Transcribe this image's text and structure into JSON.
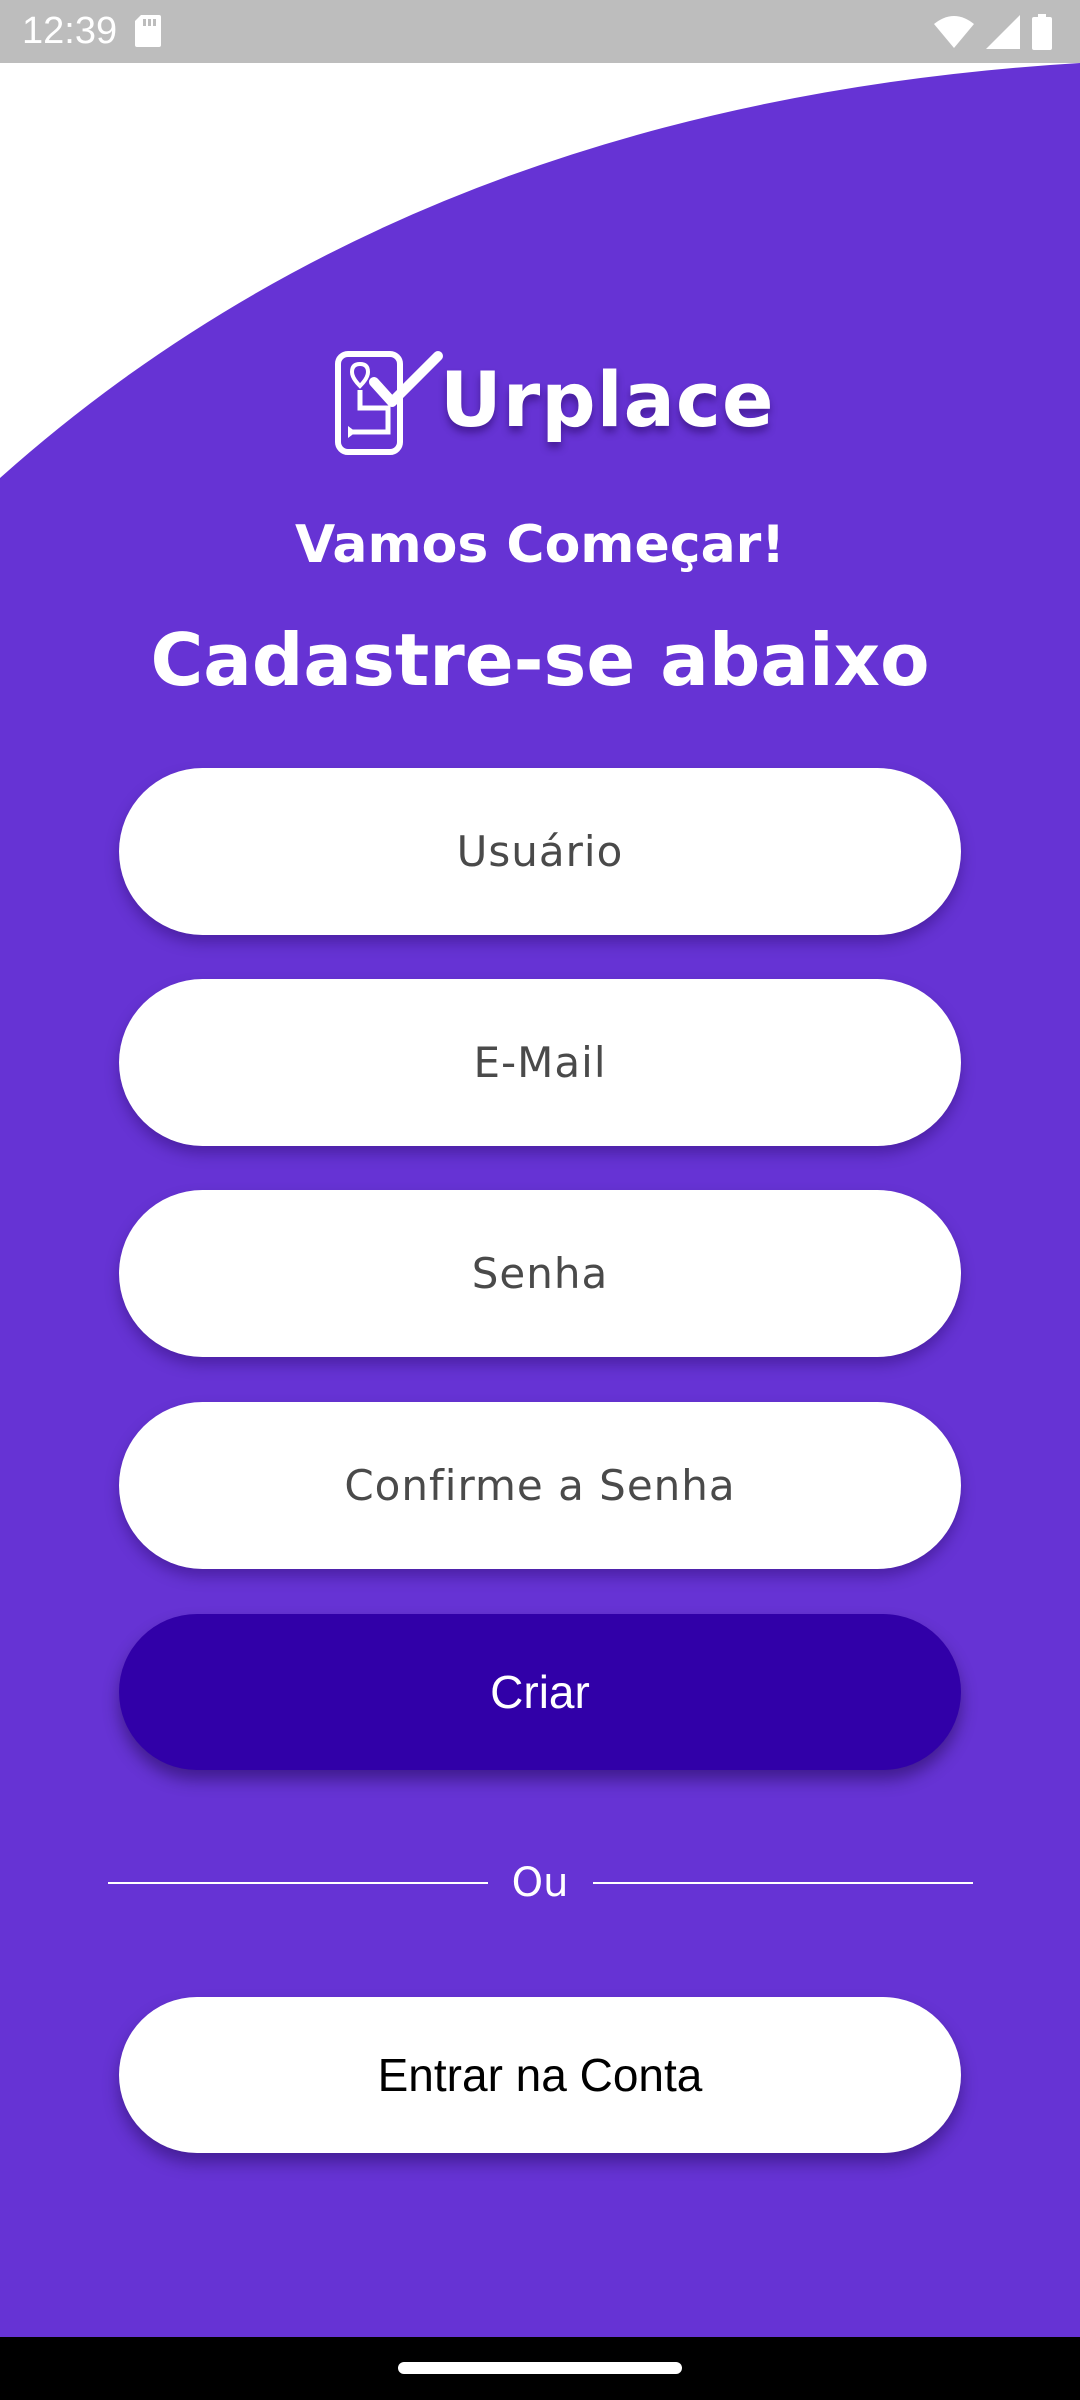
{
  "status_bar": {
    "time": "12:39",
    "icons": [
      "sd-card-icon",
      "wifi-icon",
      "signal-icon",
      "battery-icon"
    ]
  },
  "colors": {
    "primary": "#6633d4",
    "button_dark": "#3100a8",
    "field_bg": "#ffffff",
    "text_light": "#ffffff",
    "nav_bar": "#000000",
    "status_bar": "#bdbdbd"
  },
  "brand": {
    "name": "Urplace",
    "logo_icon": "phone-check-logo-icon"
  },
  "header": {
    "subtitle": "Vamos Começar!",
    "title": "Cadastre-se abaixo"
  },
  "form": {
    "username_placeholder": "Usuário",
    "email_placeholder": "E-Mail",
    "password_placeholder": "Senha",
    "confirm_password_placeholder": "Confirme a Senha",
    "submit_label": "Criar"
  },
  "divider": {
    "text": "Ou"
  },
  "login_button_label": "Entrar na Conta"
}
